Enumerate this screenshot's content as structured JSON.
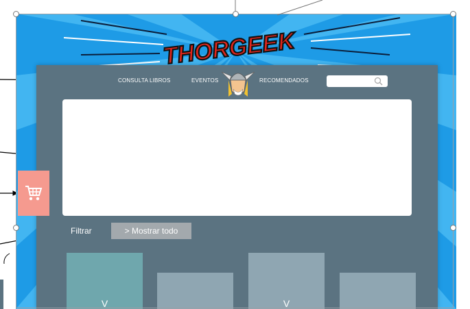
{
  "brand": {
    "title": "THORGEEK"
  },
  "nav": {
    "consulta": "CONSULTA LIBROS",
    "eventos": "EVENTOS",
    "recomendados": "RECOMENDADOS"
  },
  "search": {
    "icon": "search-icon",
    "value": ""
  },
  "cart": {
    "icon": "shopping-cart-icon"
  },
  "filters": {
    "filter_label": "Filtrar",
    "show_all_label": "> Mostrar todo"
  },
  "cards": [
    {
      "chevron": "V"
    },
    {
      "chevron": ""
    },
    {
      "chevron": "V"
    },
    {
      "chevron": ""
    }
  ],
  "colors": {
    "background_blue": "#1e9be6",
    "panel": "#5b7381",
    "cart_button": "#f59a8f",
    "card_active": "#6fa7ad",
    "card": "#8fa6b2"
  }
}
